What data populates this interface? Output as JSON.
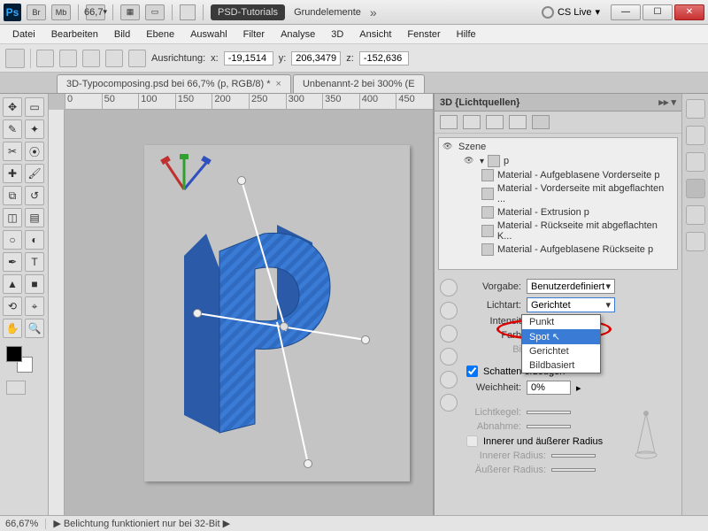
{
  "titlebar": {
    "app": "Ps",
    "icons": [
      "Br",
      "Mb"
    ],
    "zoom": "66,7",
    "workspace_btn": "PSD-Tutorials",
    "workspace_name": "Grundelemente",
    "cslive": "CS Live"
  },
  "menu": [
    "Datei",
    "Bearbeiten",
    "Bild",
    "Ebene",
    "Auswahl",
    "Filter",
    "Analyse",
    "3D",
    "Ansicht",
    "Fenster",
    "Hilfe"
  ],
  "optbar": {
    "ausrichtung": "Ausrichtung:",
    "x_label": "x:",
    "x": "-19,1514",
    "y_label": "y:",
    "y": "206,3479",
    "z_label": "z:",
    "z": "-152,636"
  },
  "tabs": [
    {
      "label": "3D-Typocomposing.psd bei 66,7% (p, RGB/8) *"
    },
    {
      "label": "Unbenannt-2 bei 300% (E"
    }
  ],
  "ruler": [
    "0",
    "50",
    "100",
    "150",
    "200",
    "250",
    "300",
    "350",
    "400",
    "450"
  ],
  "panel": {
    "title": "3D {Lichtquellen}",
    "tree": [
      {
        "label": "Szene",
        "indent": 0,
        "eye": true,
        "folder": false
      },
      {
        "label": "p",
        "indent": 1,
        "eye": true,
        "folder": true
      },
      {
        "label": "Material - Aufgeblasene Vorderseite p",
        "indent": 2
      },
      {
        "label": "Material - Vorderseite mit abgeflachten ...",
        "indent": 2
      },
      {
        "label": "Material - Extrusion p",
        "indent": 2
      },
      {
        "label": "Material - Rückseite mit abgeflachten K...",
        "indent": 2
      },
      {
        "label": "Material - Aufgeblasene Rückseite p",
        "indent": 2
      }
    ],
    "props": {
      "vorgabe_label": "Vorgabe:",
      "vorgabe": "Benutzerdefiniert",
      "lichtart_label": "Lichtart:",
      "lichtart": "Gerichtet",
      "intensitat_label": "Intensit",
      "farbe_label": "Farb",
      "bild_label": "Bi",
      "schatten": "Schatten erzeugen",
      "weichheit_label": "Weichheit:",
      "weichheit": "0%",
      "lichtkegel": "Lichtkegel:",
      "abnahme": "Abnahme:",
      "innererausserer": "Innerer und äußerer Radius",
      "innerer": "Innerer Radius:",
      "ausserer": "Äußerer Radius:"
    },
    "dropdown": [
      "Punkt",
      "Spot",
      "Gerichtet",
      "Bildbasiert"
    ],
    "dropdown_selected": 1
  },
  "status": {
    "zoom": "66,67%",
    "msg": "Belichtung funktioniert nur bei 32-Bit"
  }
}
